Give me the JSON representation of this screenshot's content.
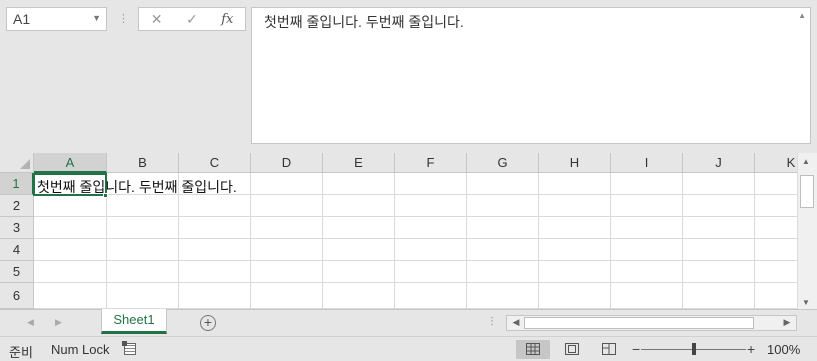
{
  "namebox": {
    "value": "A1"
  },
  "formula_buttons": {
    "cancel": "✕",
    "enter": "✓",
    "fx": "fx"
  },
  "formula_bar": {
    "content": "첫번째 줄입니다. 두번째 줄입니다."
  },
  "columns": [
    "A",
    "B",
    "C",
    "D",
    "E",
    "F",
    "G",
    "H",
    "I",
    "J",
    "K"
  ],
  "rows": [
    "1",
    "2",
    "3",
    "4",
    "5",
    "6"
  ],
  "cells": {
    "A1": "첫번째 줄입니다. 두번째 줄입니다."
  },
  "sheets": [
    {
      "name": "Sheet1",
      "active": true
    }
  ],
  "status": {
    "ready": "준비",
    "num_lock": "Num Lock",
    "zoom": "100%",
    "zoom_fraction": 0.5
  },
  "colors": {
    "accent": "#217346"
  }
}
